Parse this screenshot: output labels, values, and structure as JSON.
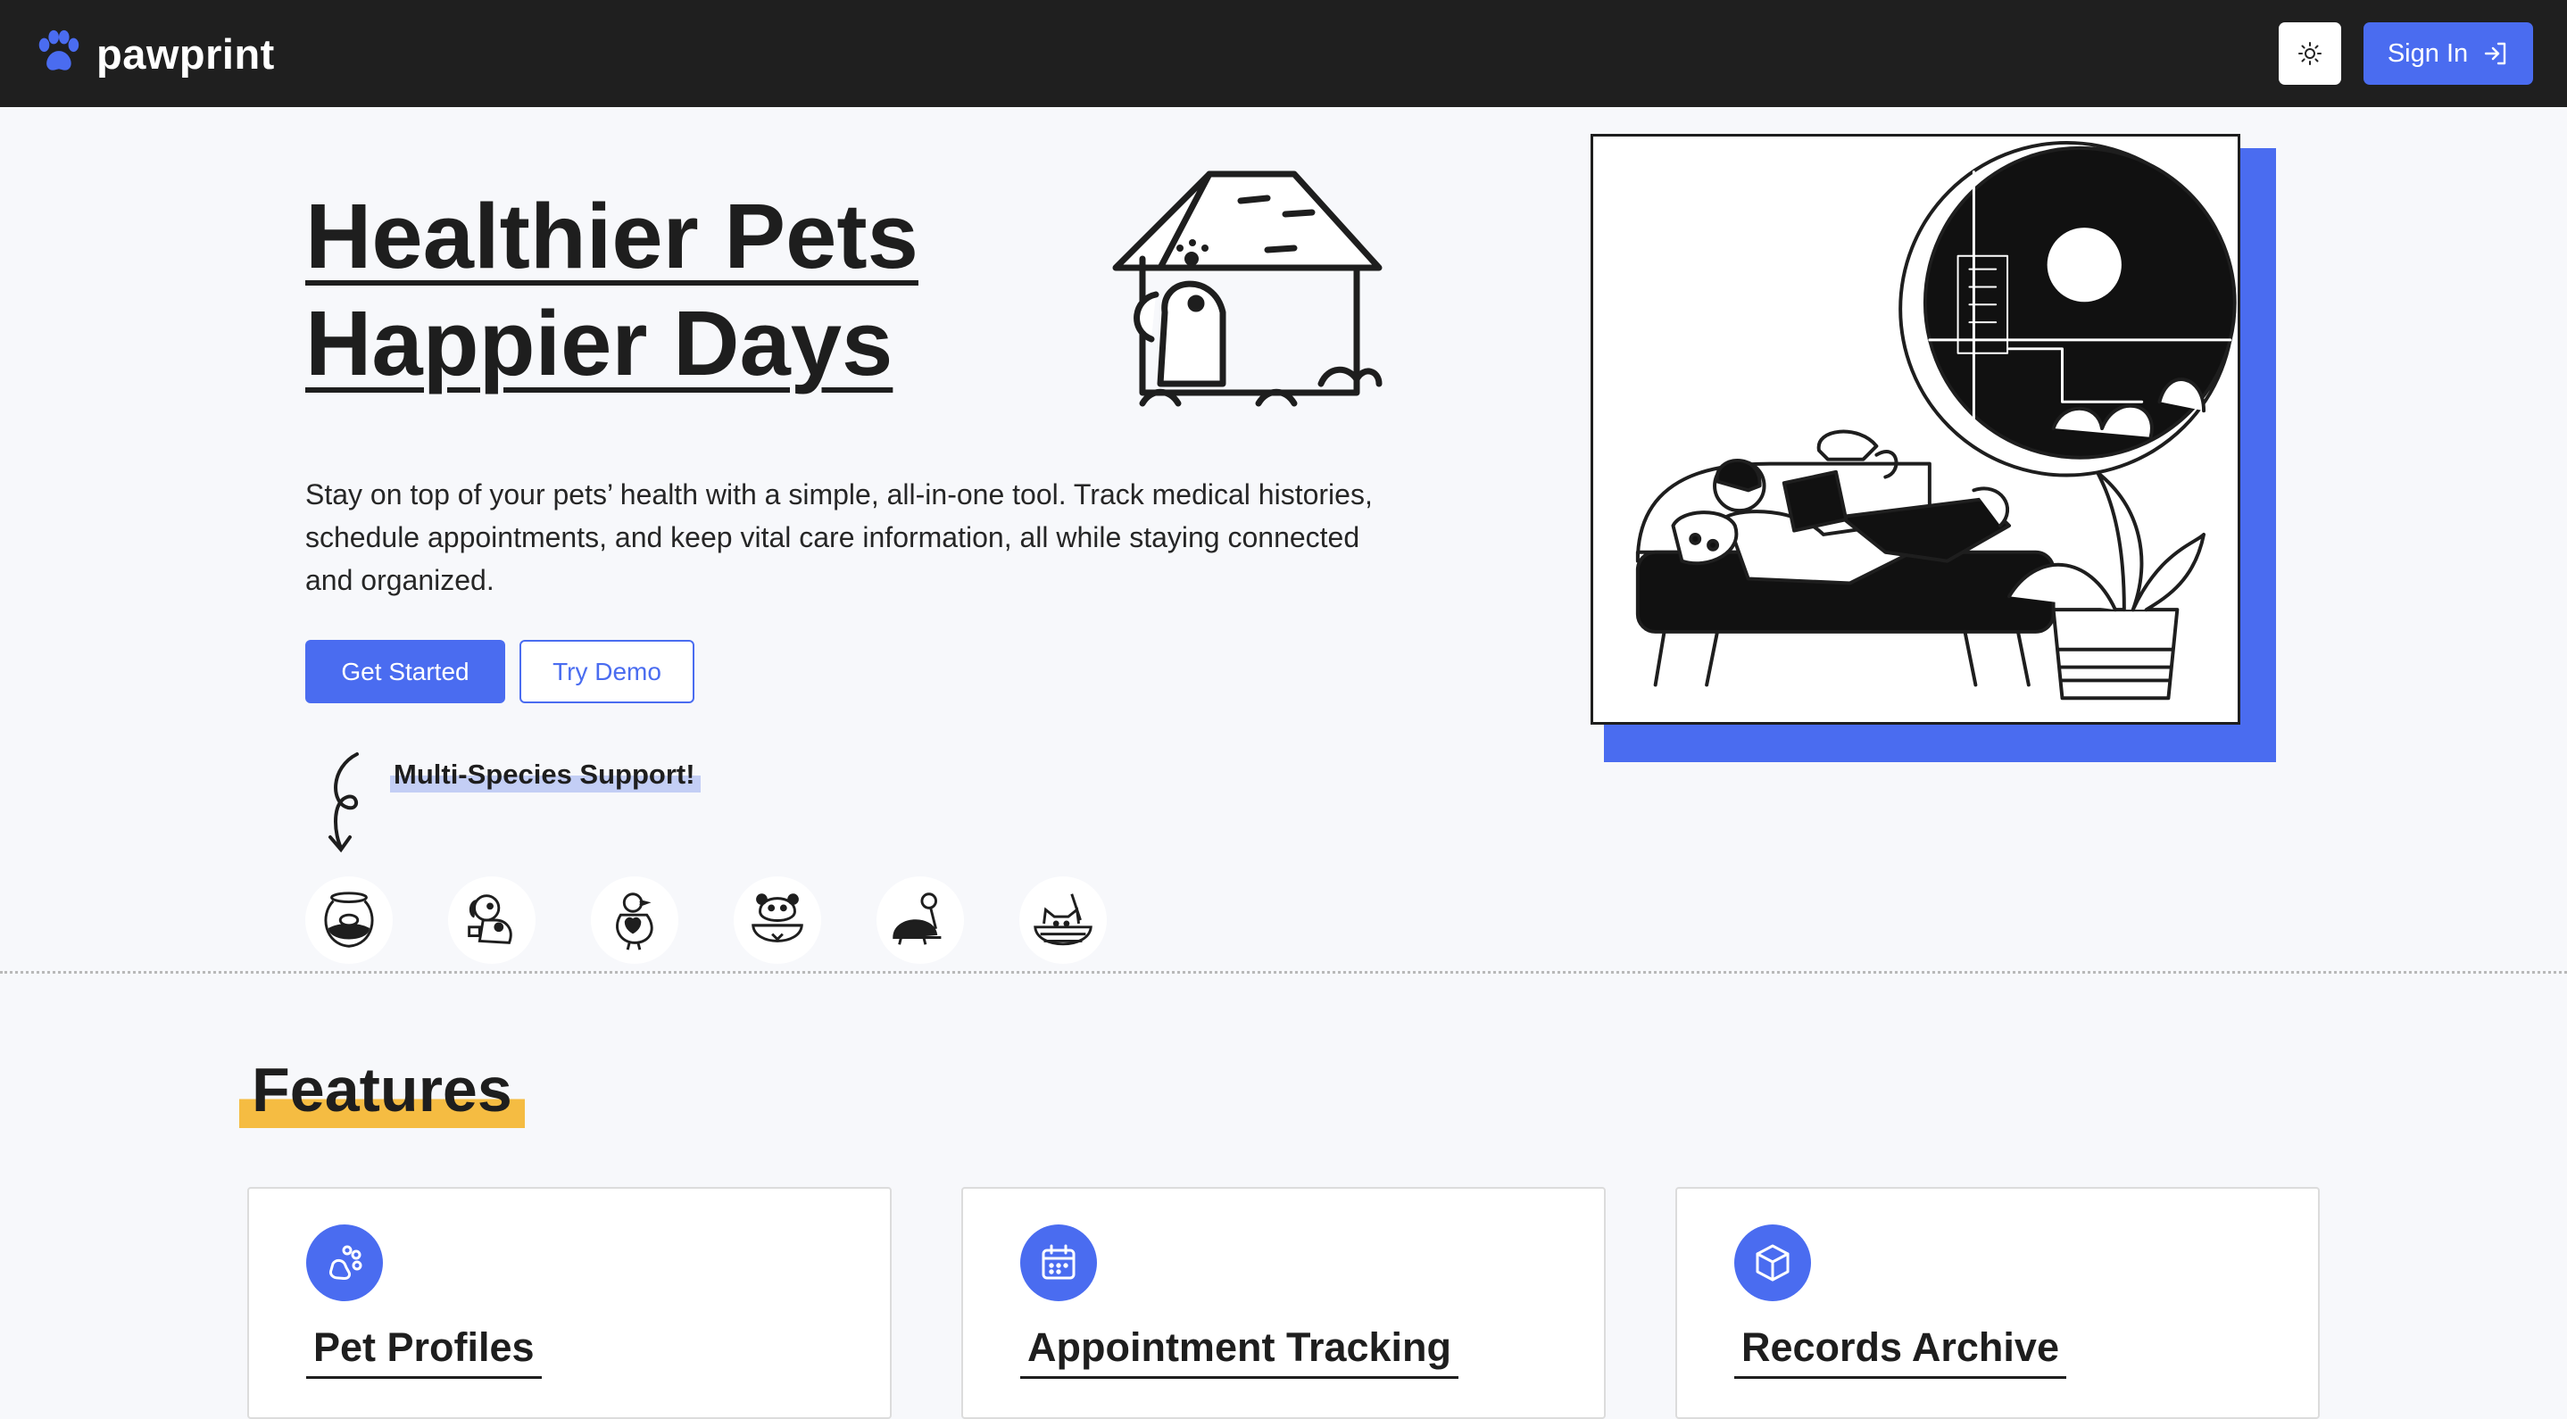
{
  "nav": {
    "brand": "pawprint",
    "theme_icon": "sun-icon",
    "signin_label": "Sign In",
    "signin_icon": "sign-in-icon"
  },
  "hero": {
    "title_line1": "Healthier Pets",
    "title_line2": "Happier Days",
    "description": "Stay on top of your pets’ health with a simple, all-in-one tool. Track medical histories, schedule appointments, and keep vital care information, all while staying connected and organized.",
    "primary_button": "Get Started",
    "secondary_button": "Try Demo",
    "species_label": "Multi-Species Support!",
    "species_icons": [
      "fish-bowl-icon",
      "dog-icon",
      "bird-icon",
      "hamster-icon",
      "turtle-icon",
      "cat-basket-icon"
    ]
  },
  "features": {
    "title": "Features",
    "cards": [
      {
        "title": "Pet Profiles",
        "icon": "paw-icon"
      },
      {
        "title": "Appointment Tracking",
        "icon": "calendar-icon"
      },
      {
        "title": "Records Archive",
        "icon": "box-icon"
      }
    ]
  },
  "colors": {
    "accent": "#4a6cf0",
    "nav_background": "#1f1f1f",
    "highlight_yellow": "#f5bc42",
    "highlight_blue": "#c3cef5",
    "page_background": "#f7f8fb"
  }
}
